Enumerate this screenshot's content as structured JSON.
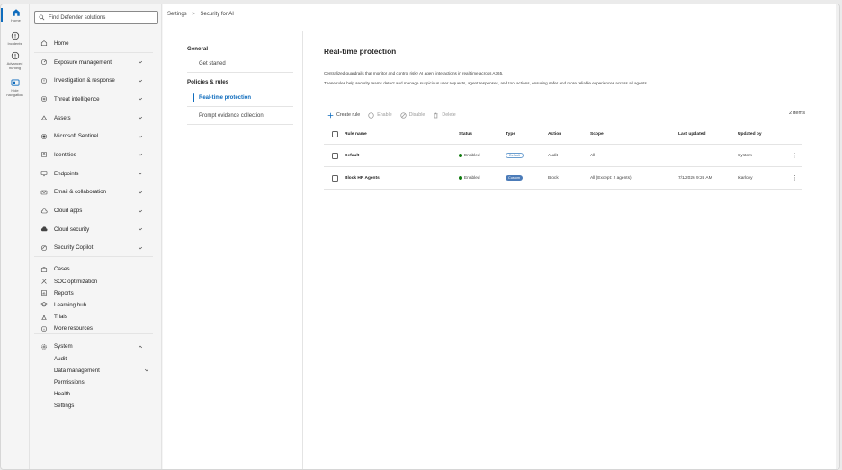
{
  "rail": [
    {
      "label": "Home",
      "icon": "home-icon",
      "active": true
    },
    {
      "label": "Incidents",
      "icon": "shield-alert-icon"
    },
    {
      "label": "Advanced hunting",
      "icon": "hunting-icon"
    },
    {
      "label": "Hide navigation",
      "icon": "panel-icon"
    }
  ],
  "search": {
    "placeholder": "Find Defender solutions"
  },
  "nav": {
    "main": [
      {
        "label": "Home",
        "icon": "home-icon",
        "chevron": false
      },
      {
        "label": "Exposure management",
        "icon": "exposure-icon",
        "chevron": true
      },
      {
        "label": "Investigation & response",
        "icon": "investigation-icon",
        "chevron": true
      },
      {
        "label": "Threat intelligence",
        "icon": "threat-intel-icon",
        "chevron": true
      },
      {
        "label": "Assets",
        "icon": "assets-icon",
        "chevron": true
      },
      {
        "label": "Microsoft Sentinel",
        "icon": "sentinel-icon",
        "chevron": true
      },
      {
        "label": "Identities",
        "icon": "identities-icon",
        "chevron": true
      },
      {
        "label": "Endpoints",
        "icon": "endpoints-icon",
        "chevron": true
      },
      {
        "label": "Email & collaboration",
        "icon": "email-icon",
        "chevron": true
      },
      {
        "label": "Cloud apps",
        "icon": "cloud-icon",
        "chevron": true
      },
      {
        "label": "Cloud security",
        "icon": "cloud-security-icon",
        "chevron": true
      },
      {
        "label": "Security Copilot",
        "icon": "copilot-icon",
        "chevron": true
      }
    ],
    "tools": [
      {
        "label": "Cases",
        "icon": "cases-icon"
      },
      {
        "label": "SOC optimization",
        "icon": "soc-icon"
      },
      {
        "label": "Reports",
        "icon": "reports-icon"
      },
      {
        "label": "Learning hub",
        "icon": "learning-icon"
      },
      {
        "label": "Trials",
        "icon": "trials-icon"
      },
      {
        "label": "More resources",
        "icon": "info-icon"
      }
    ],
    "system": {
      "label": "System",
      "icon": "gear-icon"
    },
    "system_items": [
      {
        "label": "Audit",
        "chevron": false
      },
      {
        "label": "Data management",
        "chevron": true
      },
      {
        "label": "Permissions",
        "chevron": false
      },
      {
        "label": "Health",
        "chevron": false
      },
      {
        "label": "Settings",
        "chevron": false
      }
    ]
  },
  "breadcrumb": {
    "root": "Settings",
    "sep": ">",
    "current": "Security for AI"
  },
  "subnav": {
    "general_heading": "General",
    "get_started": "Get started",
    "policies_heading": "Policies & rules",
    "realtime": "Real-time protection",
    "prompt": "Prompt evidence collection"
  },
  "main": {
    "title": "Real-time protection",
    "desc1": "Centralized guardrails that monitor and control risky AI agent interactions in real time across A365.",
    "desc2": "These rules help security teams detect and manage suspicious user requests, agent responses, and tool actions, ensuring safer and more reliable experiences across all agents."
  },
  "toolbar": {
    "create": "Create rule",
    "enable": "Enable",
    "disable": "Disable",
    "delete": "Delete",
    "count": "2 items"
  },
  "table": {
    "headers": {
      "name": "Rule name",
      "status": "Status",
      "type": "Type",
      "action": "Action",
      "scope": "Scope",
      "updated": "Last updated",
      "by": "Updated by"
    },
    "rows": [
      {
        "name": "Default",
        "status": "Enabled",
        "type": "Default",
        "action": "Audit",
        "scope": "All",
        "updated": "-",
        "by": "System",
        "menu": "⋮"
      },
      {
        "name": "Block HR Agents",
        "status": "Enabled",
        "type": "Custom",
        "action": "Block",
        "scope": "All (Except: 2 agents)",
        "updated": "7/1/2026 9:26 AM",
        "by": "Ikarlovy",
        "menu": "⋮"
      }
    ]
  },
  "colors": {
    "accent": "#0f6cbd",
    "enabled": "#0e7a0d"
  }
}
